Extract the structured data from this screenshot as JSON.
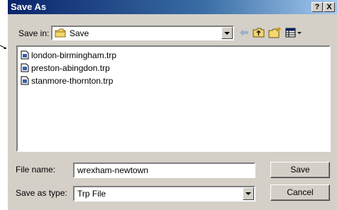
{
  "title": "Save As",
  "title_buttons": {
    "help": "?",
    "close": "X"
  },
  "save_in": {
    "label": "Save in:",
    "folder": "Save"
  },
  "toolbar": [
    {
      "icon": "back-arrow-icon"
    },
    {
      "icon": "up-folder-icon"
    },
    {
      "icon": "new-folder-icon"
    },
    {
      "icon": "view-menu-icon"
    }
  ],
  "files": [
    {
      "name": "london-birmingham.trp"
    },
    {
      "name": "preston-abingdon.trp"
    },
    {
      "name": "stanmore-thornton.trp"
    }
  ],
  "file_name": {
    "label": "File name:",
    "value": "wrexham-newtown"
  },
  "save_as_type": {
    "label": "Save as type:",
    "value": "Trp File"
  },
  "buttons": {
    "save": "Save",
    "cancel": "Cancel"
  },
  "colors": {
    "title_start": "#0a246a",
    "title_end": "#a6caf0",
    "face": "#d4d0c8"
  }
}
